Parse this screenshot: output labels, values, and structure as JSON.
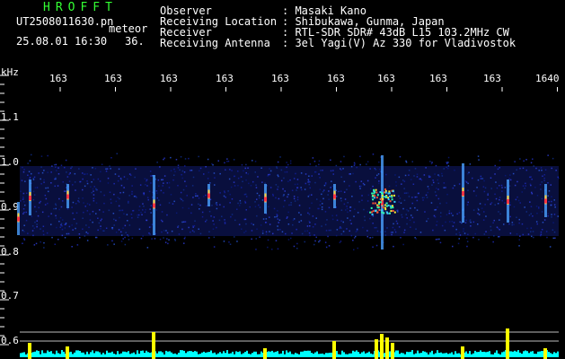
{
  "header": {
    "title": "HROFFT",
    "filename": "UT2508011630.pn",
    "meteor_label": "meteor",
    "datetime": "25.08.01 16:30",
    "count": "36.",
    "fields": [
      {
        "key": "Observer",
        "value": ": Masaki Kano"
      },
      {
        "key": "Receiving Location",
        "value": ": Shibukawa, Gunma, Japan"
      },
      {
        "key": "Receiver",
        "value": ": RTL-SDR SDR# 43dB L15 103.2MHz CW"
      },
      {
        "key": "Receiving Antenna",
        "value": ": 3el Yagi(V) Az 330 for Vladivostok"
      }
    ]
  },
  "plot": {
    "y_unit": "kHz",
    "x_ticks": [
      "163",
      "163",
      "163",
      "163",
      "163",
      "163",
      "163",
      "163",
      "163",
      "1640"
    ],
    "y_ticks": [
      "1.1",
      "1.0",
      "0.9",
      "0.8",
      "0.7",
      "0.6"
    ],
    "colors": {
      "text": "#ffffff",
      "title": "#33ff33",
      "spectrum_peak": "#ffff00",
      "noise_floor": "#00ffff",
      "band": "#1a2ab0"
    },
    "meteor_events": [
      {
        "freq_khz": 0.92,
        "strength": 0.9
      },
      {
        "freq_khz": 0.9,
        "strength": 0.7
      },
      {
        "freq_khz": 0.91,
        "strength": 1.0
      },
      {
        "freq_khz": 0.92,
        "strength": 0.6
      }
    ]
  }
}
